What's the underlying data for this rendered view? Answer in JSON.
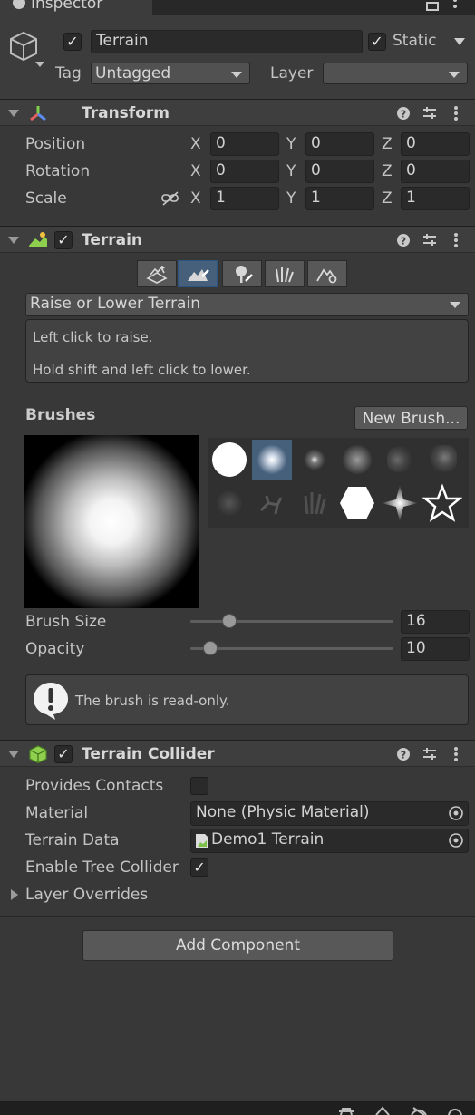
{
  "window": {
    "tab_title": "Inspector",
    "icon": "info-icon"
  },
  "object": {
    "name": "Terrain",
    "active": true,
    "static_label": "Static",
    "static_checked": true,
    "tag_label": "Tag",
    "tag_value": "Untagged",
    "layer_label": "Layer",
    "layer_value": ""
  },
  "transform": {
    "title": "Transform",
    "rows": [
      {
        "label": "Position",
        "x": "0",
        "y": "0",
        "z": "0"
      },
      {
        "label": "Rotation",
        "x": "0",
        "y": "0",
        "z": "0"
      },
      {
        "label": "Scale",
        "x": "1",
        "y": "1",
        "z": "1"
      }
    ],
    "axes": {
      "x": "X",
      "y": "Y",
      "z": "Z"
    }
  },
  "terrain": {
    "title": "Terrain",
    "enabled": true,
    "tool_icons": [
      "create-neighbor-icon",
      "paint-terrain-icon",
      "paint-trees-icon",
      "paint-details-icon",
      "terrain-settings-icon"
    ],
    "active_tool_index": 1,
    "tool_dropdown": "Raise or Lower Terrain",
    "help_line1": "Left click to raise.",
    "help_line2": "Hold shift and left click to lower.",
    "brushes_label": "Brushes",
    "new_brush_label": "New Brush...",
    "selected_brush_index": 1,
    "brush_size_label": "Brush Size",
    "brush_size_value": "16",
    "brush_size_fraction": 0.19,
    "opacity_label": "Opacity",
    "opacity_value": "10",
    "opacity_fraction": 0.1,
    "readonly_message": "The brush is read-only."
  },
  "collider": {
    "title": "Terrain Collider",
    "enabled": true,
    "provides_contacts_label": "Provides Contacts",
    "provides_contacts": false,
    "material_label": "Material",
    "material_value": "None (Physic Material)",
    "terrain_data_label": "Terrain Data",
    "terrain_data_value": "Demo1 Terrain",
    "tree_collider_label": "Enable Tree Collider",
    "tree_collider": true,
    "layer_overrides_label": "Layer Overrides"
  },
  "add_component_label": "Add Component",
  "colors": {
    "accent": "#46607c",
    "background": "#383838",
    "field": "#2a2a2a"
  }
}
